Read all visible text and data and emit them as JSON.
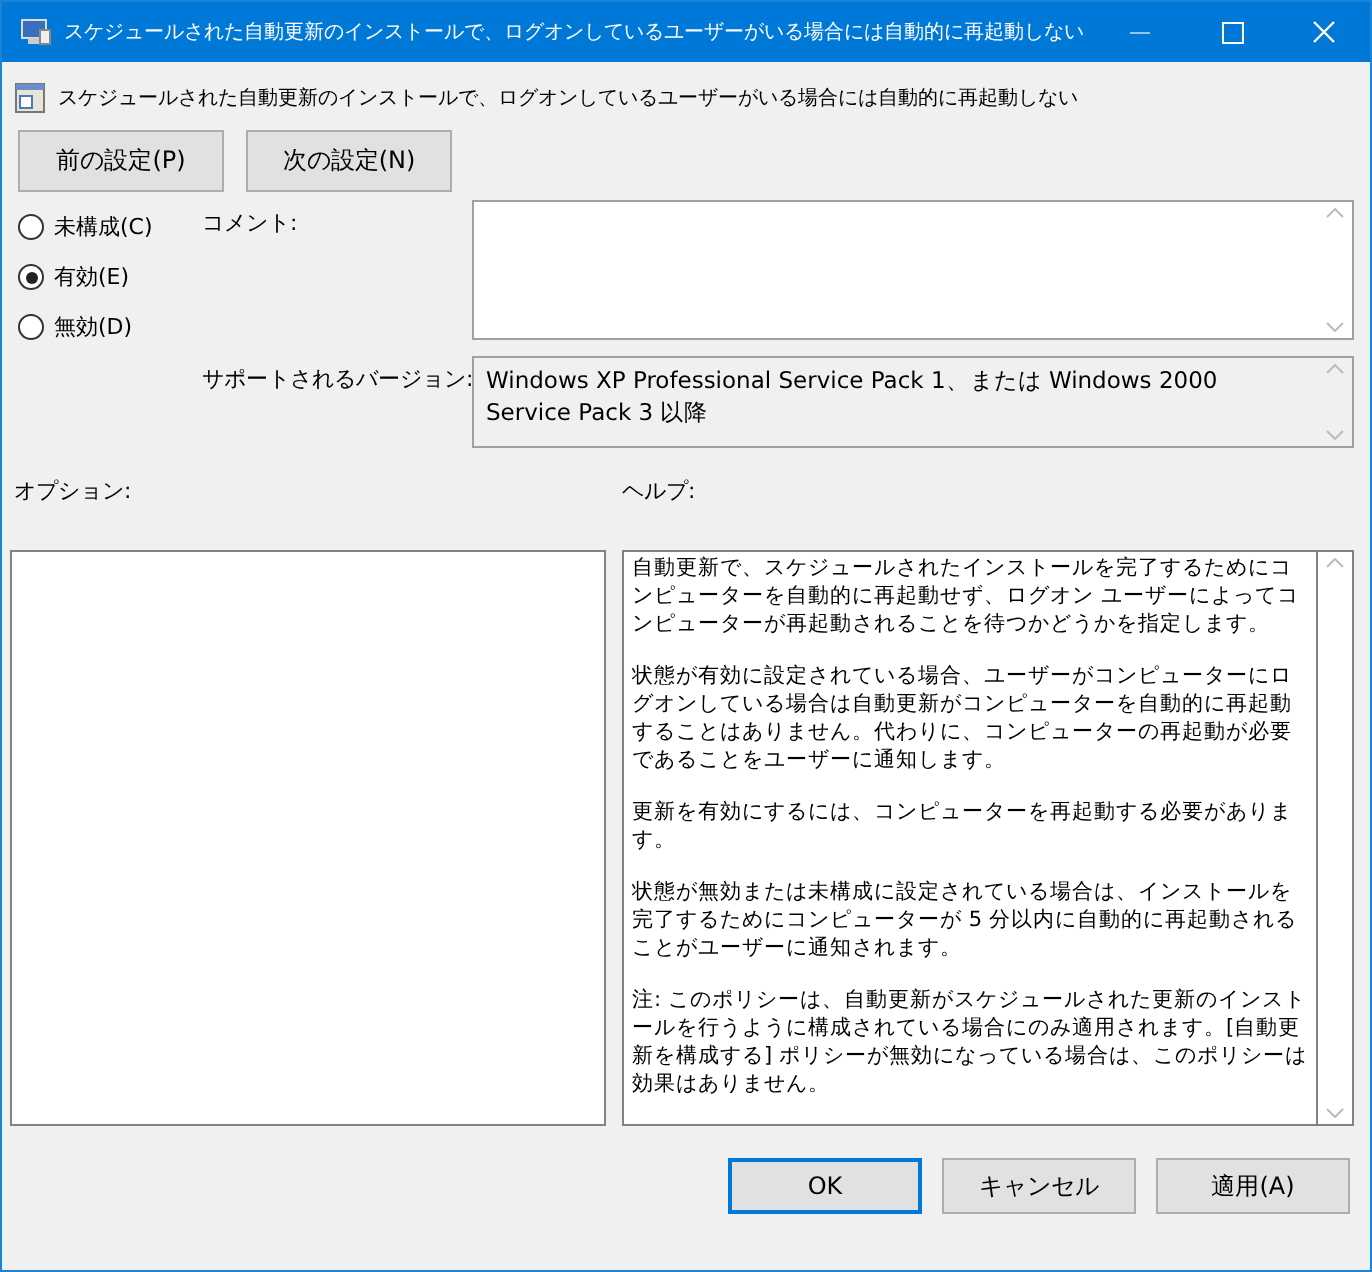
{
  "window": {
    "title": "スケジュールされた自動更新のインストールで、ログオンしているユーザーがいる場合には自動的に再起動しない"
  },
  "policy_title": "スケジュールされた自動更新のインストールで、ログオンしているユーザーがいる場合には自動的に再起動しない",
  "nav_buttons": [
    "前の設定(P)",
    "次の設定(N)"
  ],
  "states": [
    {
      "label": "未構成(C)",
      "selected": false
    },
    {
      "label": "有効(E)",
      "selected": true
    },
    {
      "label": "無効(D)",
      "selected": false
    }
  ],
  "comment": {
    "label": "コメント:"
  },
  "supported": {
    "label": "サポートされるバージョン:",
    "value": "Windows XP Professional Service Pack 1、または Windows 2000 Service Pack 3 以降"
  },
  "options": {
    "label": "オプション:"
  },
  "help": {
    "label": "ヘルプ:",
    "paragraphs": [
      "自動更新で、スケジュールされたインストールを完了するためにコンピューターを自動的に再起動せず、ログオン ユーザーによってコンピューターが再起動されることを待つかどうかを指定します。",
      "状態が有効に設定されている場合、ユーザーがコンピューターにログオンしている場合は自動更新がコンピューターを自動的に再起動することはありません。代わりに、コンピューターの再起動が必要であることをユーザーに通知します。",
      "更新を有効にするには、コンピューターを再起動する必要があります。",
      "状態が無効または未構成に設定されている場合は、インストールを完了するためにコンピューターが 5 分以内に自動的に再起動されることがユーザーに通知されます。",
      "注: このポリシーは、自動更新がスケジュールされた更新のインストールを行うように構成されている場合にのみ適用されます。[自動更新を構成する] ポリシーが無効になっている場合は、このポリシーは効果はありません。"
    ]
  },
  "buttons": [
    {
      "label": "OK",
      "default": true
    },
    {
      "label": "キャンセル",
      "default": false
    },
    {
      "label": "適用(A)",
      "default": false
    }
  ]
}
